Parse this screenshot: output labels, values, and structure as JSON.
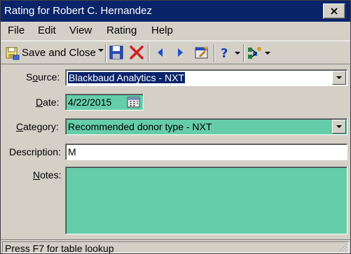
{
  "window": {
    "title": "Rating for Robert C. Hernandez",
    "close_glyph": "×"
  },
  "menu": {
    "items": [
      {
        "label": "File"
      },
      {
        "label": "Edit"
      },
      {
        "label": "View"
      },
      {
        "label": "Rating"
      },
      {
        "label": "Help"
      }
    ]
  },
  "toolbar": {
    "save_close_label": "Save and Close",
    "icons": [
      "save-close-icon",
      "dropdown-arrow-icon",
      "save-icon",
      "delete-icon",
      "previous-icon",
      "next-icon",
      "properties-icon",
      "help-icon",
      "help-dropdown-icon",
      "config-icon",
      "config-dropdown-icon"
    ]
  },
  "form": {
    "source_label_pre": "S",
    "source_label_acc": "o",
    "source_label_post": "urce:",
    "source_value": "Blackbaud Analytics - NXT",
    "date_label_pre": "",
    "date_label_acc": "D",
    "date_label_post": "ate:",
    "date_value": "4/22/2015",
    "category_label_pre": "",
    "category_label_acc": "C",
    "category_label_post": "ategory:",
    "category_value": "Recommended donor type - NXT",
    "description_label": "Description:",
    "description_value": "M",
    "notes_label_pre": "",
    "notes_label_acc": "N",
    "notes_label_post": "otes:",
    "notes_value": ""
  },
  "status": {
    "text": "Press F7 for table lookup"
  },
  "colors": {
    "titlebar": "#0a246a",
    "field_required": "#66cdaa",
    "chrome": "#d4d0c8"
  }
}
